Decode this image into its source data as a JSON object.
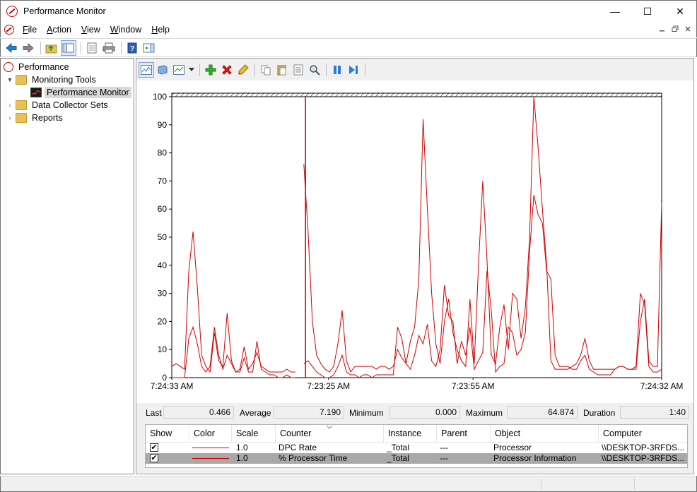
{
  "window": {
    "title": "Performance Monitor",
    "minimize_glyph": "—",
    "maximize_glyph": "☐",
    "close_glyph": "✕"
  },
  "menu": {
    "items": [
      {
        "accel": "F",
        "rest": "ile"
      },
      {
        "accel": "A",
        "rest": "ction"
      },
      {
        "accel": "V",
        "rest": "iew"
      },
      {
        "accel": "W",
        "rest": "indow"
      },
      {
        "accel": "H",
        "rest": "elp"
      }
    ]
  },
  "tree": {
    "root": "Performance",
    "monitoring_tools": "Monitoring Tools",
    "performance_monitor": "Performance Monitor",
    "data_collector_sets": "Data Collector Sets",
    "reports": "Reports"
  },
  "stats": {
    "last_label": "Last",
    "last_value": "0.466",
    "average_label": "Average",
    "average_value": "7.190",
    "minimum_label": "Minimum",
    "minimum_value": "0.000",
    "maximum_label": "Maximum",
    "maximum_value": "64.874",
    "duration_label": "Duration",
    "duration_value": "1:40"
  },
  "legend": {
    "headers": {
      "show": "Show",
      "color": "Color",
      "scale": "Scale",
      "counter": "Counter",
      "instance": "Instance",
      "parent": "Parent",
      "object": "Object",
      "computer": "Computer"
    },
    "rows": [
      {
        "checked": "✔",
        "scale": "1.0",
        "counter": "DPC Rate",
        "instance": "_Total",
        "parent": "---",
        "object": "Processor",
        "computer": "\\\\DESKTOP-3RFDS..."
      },
      {
        "checked": "✔",
        "scale": "1.0",
        "counter": "% Processor Time",
        "instance": "_Total",
        "parent": "---",
        "object": "Processor Information",
        "computer": "\\\\DESKTOP-3RFDS..."
      }
    ]
  },
  "colors": {
    "series": "#d00000",
    "selected_row": "#a9a9a9"
  },
  "chart_data": {
    "type": "line",
    "ylim": [
      0,
      100
    ],
    "yticks": [
      "0",
      "10",
      "20",
      "30",
      "40",
      "50",
      "60",
      "70",
      "80",
      "90",
      "100"
    ],
    "xtick_labels": [
      "7:24:33 AM",
      "7:23:25 AM",
      "7:23:55 AM",
      "7:24:32 AM"
    ],
    "xtick_positions": [
      0,
      0.32,
      0.615,
      1
    ],
    "current_time_index": 0.273,
    "series": [
      {
        "values": [
          4,
          5,
          4,
          3,
          38,
          52,
          32,
          8,
          4,
          2,
          16,
          6,
          4,
          23,
          6,
          2,
          3,
          11,
          3,
          5,
          9,
          4,
          3,
          2,
          2,
          2,
          2,
          3,
          2,
          2,
          null,
          76,
          52,
          20,
          8,
          5,
          3,
          2,
          4,
          12,
          24,
          6,
          2,
          4,
          4,
          4,
          4,
          4,
          3,
          4,
          4,
          3,
          4,
          10,
          7,
          5,
          13,
          18,
          35,
          92,
          60,
          30,
          12,
          5,
          20,
          28,
          16,
          10,
          6,
          4,
          28,
          5,
          40,
          70,
          42,
          8,
          5,
          18,
          26,
          10,
          30,
          28,
          14,
          25,
          50,
          100,
          82,
          60,
          40,
          6,
          3,
          3,
          3,
          3,
          4,
          5,
          8,
          14,
          6,
          3,
          3,
          3,
          3,
          3,
          3,
          4,
          4,
          3,
          3,
          3,
          20,
          28,
          6,
          4,
          4,
          62
        ]
      },
      {
        "values": [
          0,
          0,
          0,
          0,
          14,
          18,
          12,
          4,
          2,
          4,
          18,
          8,
          3,
          8,
          5,
          2,
          2,
          7,
          2,
          2,
          13,
          3,
          2,
          1,
          1,
          0,
          0,
          1,
          0,
          0,
          null,
          5,
          6,
          4,
          2,
          1,
          0,
          0,
          1,
          4,
          8,
          2,
          1,
          1,
          0,
          1,
          1,
          0,
          1,
          1,
          1,
          1,
          1,
          18,
          14,
          5,
          3,
          8,
          15,
          12,
          19,
          6,
          4,
          10,
          33,
          22,
          20,
          5,
          13,
          8,
          18,
          3,
          6,
          9,
          38,
          24,
          2,
          4,
          5,
          18,
          16,
          8,
          10,
          16,
          45,
          65,
          58,
          55,
          38,
          35,
          8,
          4,
          4,
          4,
          3,
          3,
          6,
          8,
          3,
          2,
          1,
          1,
          1,
          1,
          3,
          4,
          4,
          3,
          3,
          4,
          30,
          26,
          4,
          2,
          2,
          3
        ]
      }
    ]
  }
}
